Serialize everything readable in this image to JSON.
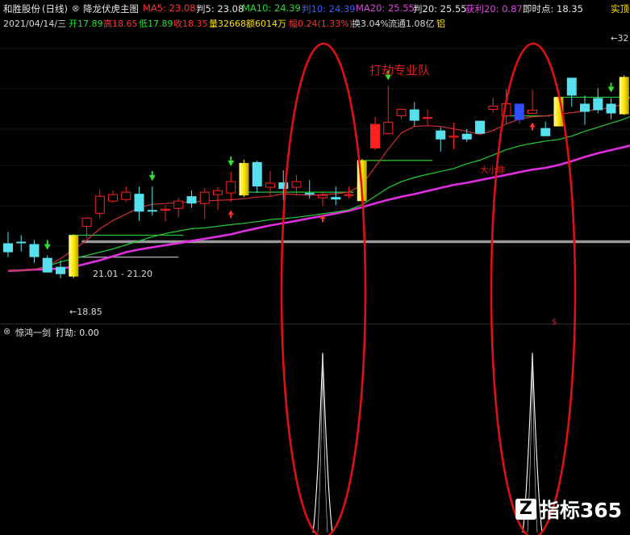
{
  "header": {
    "stock_name": "和胜股份",
    "period": "(日线)",
    "panel_toggle_glyph": "⊗",
    "main_indicator": "降龙伏虎主图",
    "ma5_label": "MA5: 23.08",
    "pan5_label": "判5: 23.08",
    "ma10_label": "MA10: 24.39",
    "pan10_label": "判10: 24.39",
    "ma20_label": "MA20: 25.55",
    "pan20_label": "判20: 25.55",
    "profit20_label": "获利20: 0.87",
    "realtime_label": "即时点: 18.35",
    "right_label": "实顶"
  },
  "quote": {
    "date": "2021/04/14/三",
    "open": "开17.89",
    "high": "高18.65",
    "low": "低17.89",
    "close": "收18.35",
    "volume": "量32668",
    "amount": "额6014万",
    "change": "幅0.24(1.33%)",
    "turnover": "换3.04%",
    "float_cap": "流通1.08亿",
    "sector": "铝"
  },
  "indicator_panel": {
    "title_glyph": "⊗",
    "name": "惊鸿一剑",
    "value_label": "打劫: 0.00"
  },
  "annotations": {
    "title_text": "打劫专业队",
    "small_label": "大小非",
    "range_label": "21.01 - 21.20",
    "low_label": "←18.85",
    "high_label": "←32",
    "dollar_mark": "$"
  },
  "watermark": {
    "logo_glyph": "Z",
    "text": "指标365"
  },
  "colors": {
    "background": "#000000",
    "up_candle": "#ff2020",
    "down_candle": "#56e0ee",
    "yellow_candle": "#ffe800",
    "blue_candle": "#2f4fff",
    "ma_long": "#e02ee0",
    "ma_mid": "#22cc33",
    "ma_short": "#d03030",
    "support_line": "#9a9a9a",
    "oval": "#e01010",
    "arrow_down": "#33dd33",
    "arrow_up": "#ff3030",
    "spike": "#ffffff"
  },
  "chart_data": {
    "type": "candlestick",
    "ylim": [
      16.5,
      34.0
    ],
    "candles": [
      {
        "o": 21.0,
        "h": 21.7,
        "l": 20.15,
        "c": 20.45,
        "kind": "down"
      },
      {
        "o": 21.0,
        "h": 21.5,
        "l": 20.5,
        "c": 21.1,
        "kind": "down"
      },
      {
        "o": 20.95,
        "h": 21.2,
        "l": 19.8,
        "c": 20.15,
        "kind": "down"
      },
      {
        "o": 20.1,
        "h": 20.25,
        "l": 19.2,
        "c": 19.2,
        "kind": "down"
      },
      {
        "o": 19.55,
        "h": 19.95,
        "l": 18.85,
        "c": 19.1,
        "kind": "down"
      },
      {
        "o": 18.95,
        "h": 21.55,
        "l": 18.85,
        "c": 21.5,
        "kind": "yellow"
      },
      {
        "o": 22.05,
        "h": 22.6,
        "l": 21.3,
        "c": 22.55,
        "kind": "up"
      },
      {
        "o": 22.85,
        "h": 24.3,
        "l": 22.55,
        "c": 23.9,
        "kind": "up"
      },
      {
        "o": 23.6,
        "h": 24.25,
        "l": 23.5,
        "c": 24.0,
        "kind": "up"
      },
      {
        "o": 23.7,
        "h": 24.5,
        "l": 23.55,
        "c": 24.15,
        "kind": "up"
      },
      {
        "o": 24.05,
        "h": 24.5,
        "l": 22.4,
        "c": 22.95,
        "kind": "down"
      },
      {
        "o": 22.95,
        "h": 24.5,
        "l": 22.7,
        "c": 23.05,
        "kind": "down"
      },
      {
        "o": 23.05,
        "h": 23.35,
        "l": 22.35,
        "c": 23.1,
        "kind": "up"
      },
      {
        "o": 23.15,
        "h": 23.8,
        "l": 22.6,
        "c": 23.6,
        "kind": "up"
      },
      {
        "o": 23.9,
        "h": 24.25,
        "l": 23.2,
        "c": 23.45,
        "kind": "down"
      },
      {
        "o": 23.45,
        "h": 24.4,
        "l": 22.5,
        "c": 24.15,
        "kind": "up"
      },
      {
        "o": 24.0,
        "h": 24.45,
        "l": 23.05,
        "c": 24.25,
        "kind": "up"
      },
      {
        "o": 24.1,
        "h": 25.4,
        "l": 23.55,
        "c": 24.8,
        "kind": "up"
      },
      {
        "o": 23.95,
        "h": 26.15,
        "l": 23.85,
        "c": 25.95,
        "kind": "yellow"
      },
      {
        "o": 26.0,
        "h": 26.1,
        "l": 24.1,
        "c": 24.5,
        "kind": "down"
      },
      {
        "o": 24.45,
        "h": 25.45,
        "l": 23.9,
        "c": 24.7,
        "kind": "up"
      },
      {
        "o": 24.75,
        "h": 25.5,
        "l": 23.65,
        "c": 24.35,
        "kind": "down"
      },
      {
        "o": 24.45,
        "h": 25.2,
        "l": 23.95,
        "c": 24.8,
        "kind": "up"
      },
      {
        "o": 24.0,
        "h": 24.9,
        "l": 23.75,
        "c": 24.1,
        "kind": "down"
      },
      {
        "o": 23.8,
        "h": 24.2,
        "l": 23.3,
        "c": 23.95,
        "kind": "up"
      },
      {
        "o": 23.7,
        "h": 24.5,
        "l": 23.35,
        "c": 23.85,
        "kind": "down"
      },
      {
        "o": 23.95,
        "h": 24.5,
        "l": 23.75,
        "c": 24.0,
        "kind": "up"
      },
      {
        "o": 23.6,
        "h": 26.2,
        "l": 23.6,
        "c": 26.1,
        "kind": "yellow"
      },
      {
        "o": 26.85,
        "h": 28.8,
        "l": 26.75,
        "c": 28.35,
        "kind": "up"
      },
      {
        "o": 27.75,
        "h": 30.7,
        "l": 27.75,
        "c": 28.45,
        "kind": "up"
      },
      {
        "o": 28.85,
        "h": 29.25,
        "l": 28.65,
        "c": 29.25,
        "kind": "up"
      },
      {
        "o": 29.25,
        "h": 29.7,
        "l": 28.2,
        "c": 28.55,
        "kind": "down"
      },
      {
        "o": 28.75,
        "h": 29.25,
        "l": 28.25,
        "c": 28.75,
        "kind": "up"
      },
      {
        "o": 27.95,
        "h": 28.15,
        "l": 26.65,
        "c": 27.4,
        "kind": "down"
      },
      {
        "o": 27.6,
        "h": 28.45,
        "l": 26.8,
        "c": 27.6,
        "kind": "up"
      },
      {
        "o": 27.75,
        "h": 28.05,
        "l": 27.25,
        "c": 27.4,
        "kind": "down"
      },
      {
        "o": 27.75,
        "h": 28.55,
        "l": 27.75,
        "c": 28.55,
        "kind": "down"
      },
      {
        "o": 29.25,
        "h": 29.95,
        "l": 29.05,
        "c": 29.45,
        "kind": "up"
      },
      {
        "o": 29.6,
        "h": 30.5,
        "l": 28.35,
        "c": 28.85,
        "kind": "up"
      },
      {
        "o": 28.6,
        "h": 29.6,
        "l": 28.35,
        "c": 29.6,
        "kind": "blue"
      },
      {
        "o": 29.2,
        "h": 30.45,
        "l": 28.95,
        "c": 29.0,
        "kind": "up"
      },
      {
        "o": 28.1,
        "h": 28.5,
        "l": 27.6,
        "c": 27.6,
        "kind": "down"
      },
      {
        "o": 28.2,
        "h": 30.2,
        "l": 28.2,
        "c": 30.0,
        "kind": "yellow"
      },
      {
        "o": 30.1,
        "h": 30.6,
        "l": 29.4,
        "c": 31.2,
        "kind": "down"
      },
      {
        "o": 29.1,
        "h": 30.1,
        "l": 28.3,
        "c": 29.6,
        "kind": "down"
      },
      {
        "o": 29.2,
        "h": 30.55,
        "l": 29.0,
        "c": 29.95,
        "kind": "down"
      },
      {
        "o": 29.0,
        "h": 29.95,
        "l": 28.65,
        "c": 29.6,
        "kind": "down"
      },
      {
        "o": 28.95,
        "h": 31.35,
        "l": 28.9,
        "c": 31.25,
        "kind": "yellow"
      },
      {
        "o": 31.4,
        "h": 33.55,
        "l": 30.9,
        "c": 33.25,
        "kind": "up"
      },
      {
        "o": 32.1,
        "h": 34.25,
        "l": 31.8,
        "c": 32.55,
        "kind": "up"
      },
      {
        "o": 33.05,
        "h": 34.05,
        "l": 31.85,
        "c": 32.3,
        "kind": "up"
      },
      {
        "o": 33.0,
        "h": 33.3,
        "l": 32.7,
        "c": 33.05,
        "kind": "up"
      },
      {
        "o": 33.55,
        "h": 34.1,
        "l": 31.65,
        "c": 32.5,
        "kind": "down"
      },
      {
        "o": 32.05,
        "h": 34.4,
        "l": 31.95,
        "c": 34.0,
        "kind": "up"
      },
      {
        "o": 32.5,
        "h": 33.5,
        "l": 31.4,
        "c": 31.7,
        "kind": "down"
      },
      {
        "o": 31.7,
        "h": 32.4,
        "l": 30.5,
        "c": 31.1,
        "kind": "down"
      }
    ],
    "ma_long": [
      19.3,
      19.33,
      19.38,
      19.4,
      19.45,
      19.55,
      19.75,
      19.95,
      20.2,
      20.45,
      20.62,
      20.75,
      20.88,
      21.0,
      21.15,
      21.28,
      21.41,
      21.55,
      21.75,
      21.93,
      22.1,
      22.24,
      22.38,
      22.54,
      22.68,
      22.84,
      23.0,
      23.22,
      23.46,
      23.68,
      23.87,
      24.03,
      24.22,
      24.41,
      24.6,
      24.73,
      24.89,
      25.05,
      25.21,
      25.38,
      25.54,
      25.65,
      25.82,
      26.06,
      26.32,
      26.55,
      26.74,
      26.93,
      27.12,
      27.31,
      27.52,
      27.7,
      27.86,
      28.02,
      28.17,
      28.3
    ],
    "ma_mid": [
      19.3,
      19.33,
      19.38,
      19.6,
      19.85,
      20.05,
      20.25,
      20.45,
      20.65,
      20.9,
      21.15,
      21.4,
      21.6,
      21.75,
      21.9,
      21.95,
      22.05,
      22.15,
      22.23,
      22.33,
      22.46,
      22.52,
      22.6,
      22.7,
      22.82,
      22.93,
      23.06,
      23.38,
      23.9,
      24.42,
      24.8,
      25.05,
      25.25,
      25.43,
      25.61,
      25.9,
      26.12,
      26.44,
      26.76,
      27.0,
      27.16,
      27.3,
      27.4,
      27.6,
      27.9,
      28.15,
      28.4,
      28.65,
      29.0,
      29.4,
      29.8,
      30.2,
      30.55,
      30.85,
      31.05,
      31.2
    ],
    "ma_short": [
      19.3,
      19.33,
      19.38,
      19.6,
      20.05,
      20.6,
      21.2,
      21.9,
      22.4,
      22.8,
      23.2,
      23.4,
      23.45,
      23.52,
      23.55,
      23.6,
      23.65,
      23.68,
      23.75,
      23.85,
      23.9,
      24.05,
      24.0,
      23.95,
      24.0,
      24.05,
      24.15,
      24.6,
      25.7,
      26.8,
      27.8,
      28.2,
      28.25,
      28.2,
      28.05,
      27.9,
      27.7,
      27.95,
      28.35,
      28.65,
      28.8,
      28.85,
      28.95,
      29.05,
      29.15,
      29.25,
      29.35,
      29.6,
      30.4,
      31.4,
      32.2,
      32.7,
      32.7,
      32.45,
      32.1,
      31.8
    ],
    "ma_short_start_index": 4,
    "support_level": 21.1,
    "support_level_2": 20.15,
    "horizontal_segments": [
      {
        "from": 5,
        "to": 13,
        "value": 21.5
      },
      {
        "from": 18,
        "to": 26,
        "value": 24.15
      },
      {
        "from": 27,
        "to": 32,
        "value": 26.1
      },
      {
        "from": 38,
        "to": 41,
        "value": 28.85
      },
      {
        "from": 42,
        "to": 55,
        "value": 30.0
      }
    ],
    "up_arrows": [
      17,
      24,
      40
    ],
    "down_arrows": [
      3,
      11,
      17,
      29,
      46
    ],
    "indicator_spikes": [
      {
        "index": 24,
        "value": 1.0
      },
      {
        "index": 40,
        "value": 1.0
      }
    ],
    "indicator_range": [
      0,
      1.1
    ]
  }
}
